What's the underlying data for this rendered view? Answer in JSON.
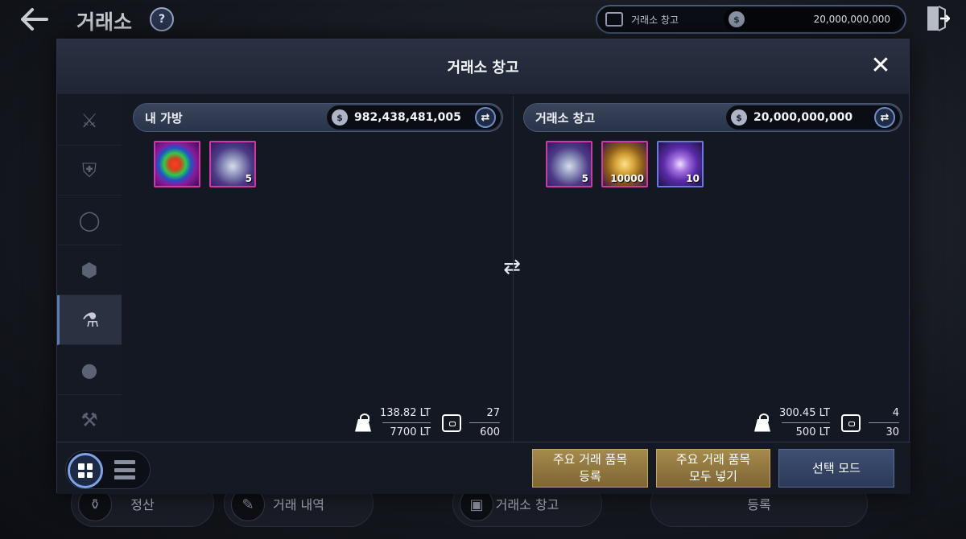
{
  "header": {
    "title": "거래소",
    "help_icon": "book-question-icon",
    "currency_bar": {
      "label": "거래소 창고",
      "coin_symbol": "$",
      "amount": "20,000,000,000"
    }
  },
  "background_buttons": [
    {
      "label": "정산",
      "icon": "money-bag-icon"
    },
    {
      "label": "거래 내역",
      "icon": "quill-icon"
    },
    {
      "label": "거래소 창고",
      "icon": "chest-icon"
    },
    {
      "label": "등록",
      "icon": ""
    }
  ],
  "modal": {
    "title": "거래소 창고",
    "close_icon": "close-icon",
    "categories": [
      {
        "icon": "crossed-swords-icon",
        "active": false
      },
      {
        "icon": "armor-icon",
        "active": false
      },
      {
        "icon": "ring-icon",
        "active": false
      },
      {
        "icon": "gem-icon",
        "active": false
      },
      {
        "icon": "potion-bag-icon",
        "active": true
      },
      {
        "icon": "bomb-icon",
        "active": false
      },
      {
        "icon": "pickaxe-hammer-icon",
        "active": false
      }
    ],
    "left_panel": {
      "title": "내 가방",
      "coin_symbol": "$",
      "balance": "982,438,481,005",
      "items": [
        {
          "icon": "rainbow-orb-icon",
          "count": ""
        },
        {
          "icon": "crystal-ore-icon",
          "count": "5"
        }
      ],
      "weight_current": "138.82 LT",
      "weight_max": "7700 LT",
      "slots_current": "27",
      "slots_max": "600"
    },
    "right_panel": {
      "title": "거래소 창고",
      "coin_symbol": "$",
      "balance": "20,000,000,000",
      "items": [
        {
          "icon": "crystal-ore-icon",
          "count": "5"
        },
        {
          "icon": "gold-ore-icon",
          "count": "10000"
        },
        {
          "icon": "purple-orb-icon",
          "count": "10"
        }
      ],
      "weight_current": "300.45 LT",
      "weight_max": "500 LT",
      "slots_current": "4",
      "slots_max": "30"
    },
    "footer": {
      "btn_register_main": "주요 거래 품목\n등록",
      "btn_put_all_main": "주요 거래 품목\n모두 넣기",
      "btn_select_mode": "선택 모드"
    }
  },
  "colors": {
    "accent_blue": "#7fa2e8",
    "gold_button": "#a58a4c",
    "item_border_epic": "#d238a3",
    "item_border_rare": "#6c79d9"
  }
}
